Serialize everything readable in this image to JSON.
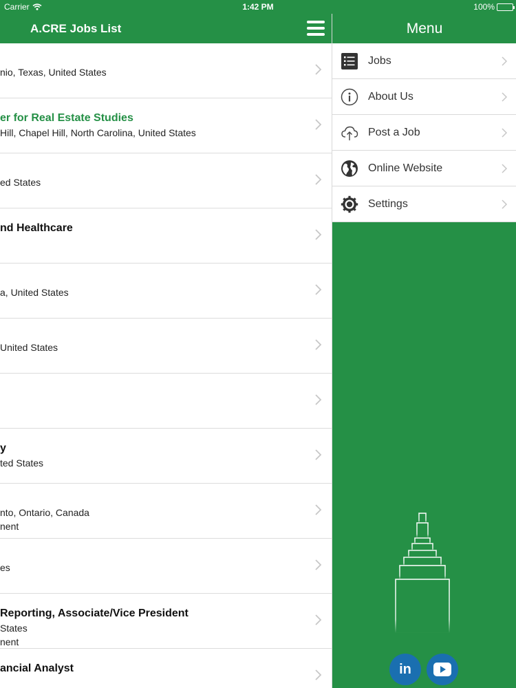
{
  "status_bar": {
    "carrier": "Carrier",
    "time": "1:42 PM",
    "battery": "100%"
  },
  "list": {
    "title": "A.CRE Jobs List",
    "rows": [
      {
        "l1": "",
        "l2": "nio, Texas, United States",
        "l3": ""
      },
      {
        "l1": "er for Real Estate Studies",
        "l2": "Hill, Chapel Hill, North Carolina, United States",
        "l3": ""
      },
      {
        "l1": "",
        "l2": "ed States",
        "l3": ""
      },
      {
        "l1": "nd Healthcare",
        "l2": "",
        "l3": ""
      },
      {
        "l1": "",
        "l2": "a, United States",
        "l3": ""
      },
      {
        "l1": "",
        "l2": "United States",
        "l3": ""
      },
      {
        "l1": "",
        "l2": "",
        "l3": ""
      },
      {
        "l1": "y",
        "l2": "ted States",
        "l3": ""
      },
      {
        "l1": "",
        "l2": "nto, Ontario, Canada",
        "l3": "nent"
      },
      {
        "l1": "",
        "l2": "es",
        "l3": ""
      },
      {
        "l1": " Reporting, Associate/Vice President",
        "l2": "States",
        "l3": "nent"
      },
      {
        "l1": "ancial Analyst",
        "l2": "",
        "l3": ""
      }
    ]
  },
  "menu": {
    "title": "Menu",
    "items": [
      {
        "label": "Jobs",
        "icon": "list-icon"
      },
      {
        "label": "About Us",
        "icon": "info-icon"
      },
      {
        "label": "Post a Job",
        "icon": "cloud-upload-icon"
      },
      {
        "label": "Online Website",
        "icon": "globe-icon"
      },
      {
        "label": "Settings",
        "icon": "gear-icon"
      }
    ],
    "social": {
      "linkedin_label": "in",
      "youtube_icon": "play-icon"
    }
  },
  "colors": {
    "brand_green": "#259046",
    "highlight_green": "#259046",
    "social_blue": "#1a6fb0"
  }
}
